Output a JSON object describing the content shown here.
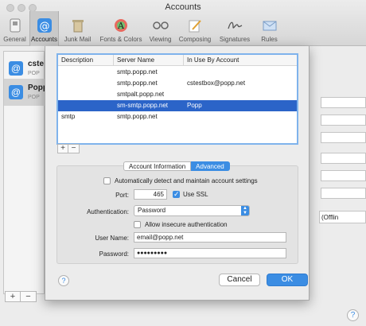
{
  "window": {
    "title": "Accounts"
  },
  "toolbar": {
    "items": [
      {
        "label": "General",
        "icon": "switch-icon"
      },
      {
        "label": "Accounts",
        "icon": "at-sign-icon",
        "selected": true
      },
      {
        "label": "Junk Mail",
        "icon": "trash-icon"
      },
      {
        "label": "Fonts & Colors",
        "icon": "fonts-colors-icon"
      },
      {
        "label": "Viewing",
        "icon": "glasses-icon"
      },
      {
        "label": "Composing",
        "icon": "pencil-icon"
      },
      {
        "label": "Signatures",
        "icon": "signature-icon"
      },
      {
        "label": "Rules",
        "icon": "envelope-rules-icon"
      }
    ]
  },
  "accounts": [
    {
      "name": "cste",
      "type": "POP"
    },
    {
      "name": "Popp",
      "type": "POP",
      "selected": true
    }
  ],
  "background": {
    "offline_value": "(Offlin"
  },
  "smtp_table": {
    "columns": [
      "Description",
      "Server Name",
      "In Use By Account"
    ],
    "rows": [
      {
        "description": "",
        "server": "smtp.popp.net",
        "account": ""
      },
      {
        "description": "",
        "server": "smtp.popp.net",
        "account": "cstestbox@popp.net"
      },
      {
        "description": "",
        "server": "smtpalt.popp.net",
        "account": ""
      },
      {
        "description": "",
        "server": "sm-smtp.popp.net",
        "account": "Popp",
        "selected": true
      },
      {
        "description": "smtp",
        "server": "smtp.popp.net",
        "account": ""
      }
    ]
  },
  "tabs": {
    "info": "Account Information",
    "advanced": "Advanced"
  },
  "advanced": {
    "auto_detect_label": "Automatically detect and maintain account settings",
    "auto_detect_checked": false,
    "port_label": "Port:",
    "port_value": "465",
    "use_ssl_label": "Use SSL",
    "use_ssl_checked": true,
    "auth_label": "Authentication:",
    "auth_value": "Password",
    "insecure_label": "Allow insecure authentication",
    "insecure_checked": false,
    "username_label": "User Name:",
    "username_value": "email@popp.net",
    "password_label": "Password:",
    "password_value": "●●●●●●●●●"
  },
  "buttons": {
    "cancel": "Cancel",
    "ok": "OK",
    "help": "?"
  },
  "plus_minus": {
    "plus": "+",
    "minus": "−"
  },
  "colors": {
    "accent": "#3b8de3",
    "selection": "#2b64c8"
  }
}
